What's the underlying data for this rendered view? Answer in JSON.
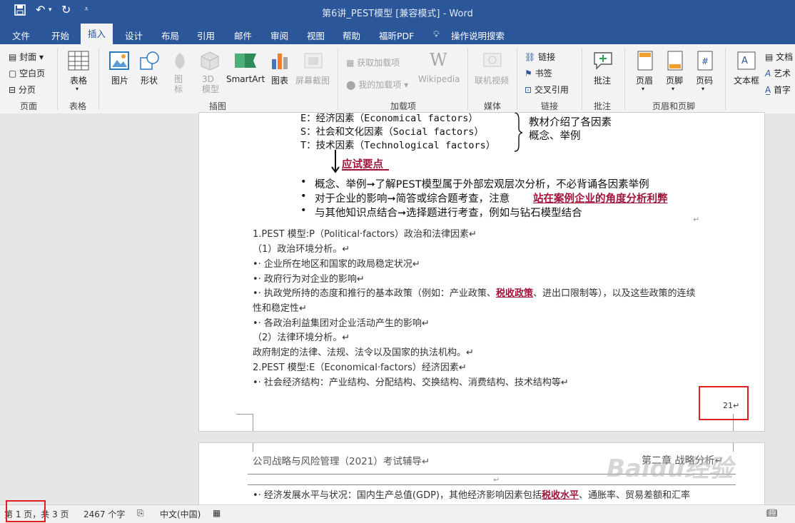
{
  "title_bar": {
    "doc_title": "第6讲_PEST模型 [兼容模式]  -  Word"
  },
  "tabs": [
    "文件",
    "开始",
    "插入",
    "设计",
    "布局",
    "引用",
    "邮件",
    "审阅",
    "视图",
    "帮助",
    "福昕PDF",
    "操作说明搜索"
  ],
  "active_tab": "插入",
  "ribbon": {
    "page_group": {
      "cover": "封面",
      "blank": "空白页",
      "break": "分页",
      "label": "页面"
    },
    "table_group": {
      "table": "表格",
      "label": "表格"
    },
    "illus_group": {
      "picture": "图片",
      "shapes": "形状",
      "icons": "图\n标",
      "model3d": "3D\n模型",
      "smartart": "SmartArt",
      "chart": "图表",
      "screenshot": "屏幕截图",
      "label": "插图"
    },
    "addins_group": {
      "get": "获取加载项",
      "my": "我的加载项",
      "wikipedia": "Wikipedia",
      "label": "加载项"
    },
    "media_group": {
      "video": "联机视频",
      "label": "媒体"
    },
    "links_group": {
      "link": "链接",
      "bookmark": "书签",
      "crossref": "交叉引用",
      "label": "链接"
    },
    "comment_group": {
      "comment": "批注",
      "label": "批注"
    },
    "hf_group": {
      "header": "页眉",
      "footer": "页脚",
      "pagenum": "页码",
      "label": "页眉和页脚"
    },
    "text_group": {
      "textbox": "文本框",
      "doc": "文档",
      "art": "艺术",
      "first": "首字"
    }
  },
  "page1": {
    "slide_lines": {
      "e": "E：经济因素（Economical factors）",
      "s": "S：社会和文化因素（Social factors）",
      "t": "T：技术因素（Technological factors）"
    },
    "brace_note_1": "教材介绍了各因素",
    "brace_note_2": "概念、举例",
    "exam_point": "应试要点",
    "bullets": [
      "概念、举例➞了解PEST模型属于外部宏观层次分析，不必背诵各因素举例",
      "对于企业的影响➞简答或综合题考查，注意",
      "与其他知识点结合➞选择题进行考查，例如与钻石模型结合"
    ],
    "bullet2_red": "站在案例企业的角度分析利弊",
    "body": {
      "l1": "1.PEST 模型:P（Political·factors）政治和法律因素↵",
      "l2": "（1）政治环境分析。↵",
      "l3": "•· 企业所在地区和国家的政局稳定状况↵",
      "l4": "•· 政府行为对企业的影响↵",
      "l5a": "•· 执政党所持的态度和推行的基本政策（例如：产业政策、",
      "l5red": "税收政策",
      "l5b": "、进出口限制等），以及这些政策的连续",
      "l6": "性和稳定性↵",
      "l7": "•· 各政治利益集团对企业活动产生的影响↵",
      "l8": "（2）法律环境分析。↵",
      "l9": "政府制定的法律、法规、法令以及国家的执法机构。↵",
      "l10": "2.PEST 模型:E（Economical·factors）经济因素↵",
      "l11": "•· 社会经济结构：产业结构、分配结构、交换结构、消费结构、技术结构等↵"
    },
    "page_number": "21↵"
  },
  "page2": {
    "header_left": "公司战略与风险管理（2021）考试辅导↵",
    "header_right": "第二章  战略分析↵",
    "line_a": "•· 经济发展水平与状况：国内生产总值(GDP)，其他经济影响因素包括",
    "line_red": "税收水平",
    "line_b": "、通胀率、贸易差额和汇率"
  },
  "status_bar": {
    "page": "第 1 页，共 3 页",
    "words": "2467 个字",
    "lang": "中文(中国)"
  },
  "watermark": "Baidu经验",
  "colors": {
    "accent": "#2b579a",
    "highlight": "#e02020",
    "red_text": "#a0143c"
  }
}
